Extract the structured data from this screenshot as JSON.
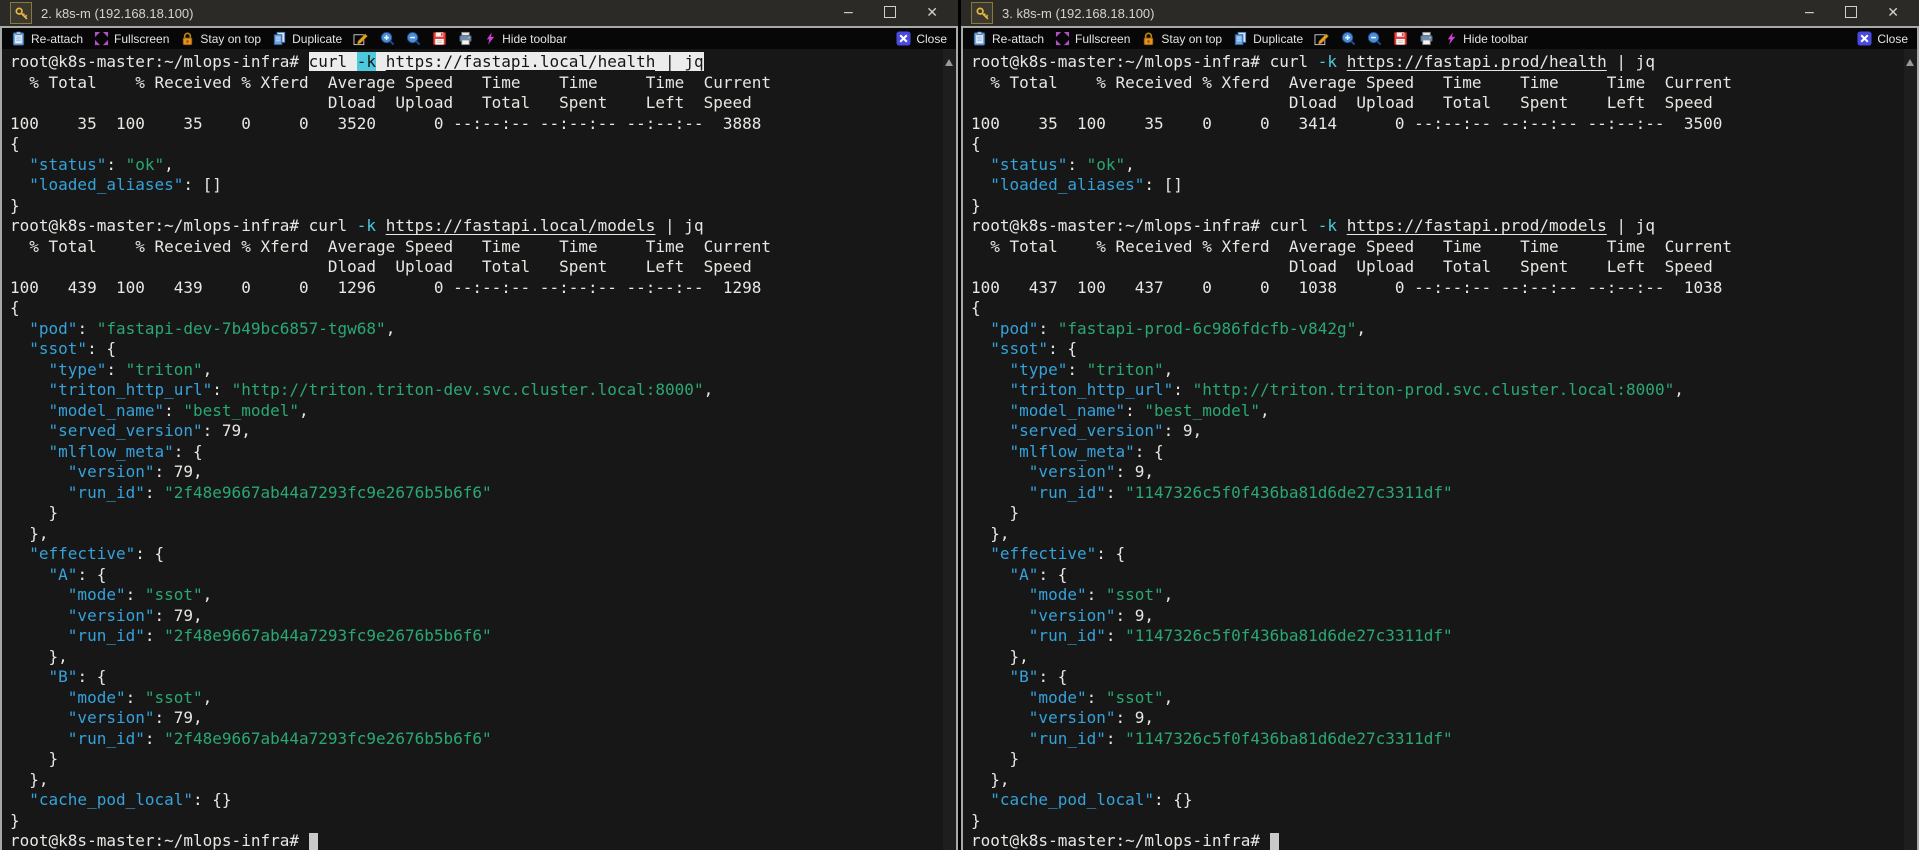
{
  "window_controls": {
    "minimize": "−",
    "close": "✕"
  },
  "toolbar": {
    "reattach": "Re-attach",
    "fullscreen": "Fullscreen",
    "stay_on_top": "Stay on top",
    "duplicate": "Duplicate",
    "hide_toolbar": "Hide toolbar",
    "close": "Close"
  },
  "left_window": {
    "title": "2. k8s-m (192.168.18.100)",
    "terminal": {
      "lines": [
        [
          [
            "t",
            "root@k8s-master:~/mlops-infra# "
          ],
          [
            "sel",
            "curl "
          ],
          [
            "selcyan",
            "-k"
          ],
          [
            "sel",
            " "
          ],
          [
            "selurl",
            "https://fastapi.local/health"
          ],
          [
            "sel",
            " | jq"
          ]
        ],
        [
          [
            "t",
            "  % Total    % Received % Xferd  Average Speed   Time    Time     Time  Current"
          ]
        ],
        [
          [
            "t",
            "                                 Dload  Upload   Total   Spent    Left  Speed"
          ]
        ],
        [
          [
            "t",
            "100    35  100    35    0     0   3520      0 --:--:-- --:--:-- --:--:--  3888"
          ]
        ],
        [
          [
            "t",
            "{"
          ]
        ],
        [
          [
            "t",
            "  "
          ],
          [
            "key",
            "\"status\""
          ],
          [
            "t",
            ": "
          ],
          [
            "str",
            "\"ok\""
          ],
          [
            "t",
            ","
          ]
        ],
        [
          [
            "t",
            "  "
          ],
          [
            "key",
            "\"loaded_aliases\""
          ],
          [
            "t",
            ": []"
          ]
        ],
        [
          [
            "t",
            "}"
          ]
        ],
        [
          [
            "t",
            "root@k8s-master:~/mlops-infra# curl "
          ],
          [
            "cyan",
            "-k"
          ],
          [
            "t",
            " "
          ],
          [
            "url",
            "https://fastapi.local/models"
          ],
          [
            "t",
            " | jq"
          ]
        ],
        [
          [
            "t",
            "  % Total    % Received % Xferd  Average Speed   Time    Time     Time  Current"
          ]
        ],
        [
          [
            "t",
            "                                 Dload  Upload   Total   Spent    Left  Speed"
          ]
        ],
        [
          [
            "t",
            "100   439  100   439    0     0   1296      0 --:--:-- --:--:-- --:--:--  1298"
          ]
        ],
        [
          [
            "t",
            "{"
          ]
        ],
        [
          [
            "t",
            "  "
          ],
          [
            "key",
            "\"pod\""
          ],
          [
            "t",
            ": "
          ],
          [
            "str",
            "\"fastapi-dev-7b49bc6857-tgw68\""
          ],
          [
            "t",
            ","
          ]
        ],
        [
          [
            "t",
            "  "
          ],
          [
            "key",
            "\"ssot\""
          ],
          [
            "t",
            ": {"
          ]
        ],
        [
          [
            "t",
            "    "
          ],
          [
            "key",
            "\"type\""
          ],
          [
            "t",
            ": "
          ],
          [
            "str",
            "\"triton\""
          ],
          [
            "t",
            ","
          ]
        ],
        [
          [
            "t",
            "    "
          ],
          [
            "key",
            "\"triton_http_url\""
          ],
          [
            "t",
            ": "
          ],
          [
            "str",
            "\"http://triton.triton-dev.svc.cluster.local:8000\""
          ],
          [
            "t",
            ","
          ]
        ],
        [
          [
            "t",
            "    "
          ],
          [
            "key",
            "\"model_name\""
          ],
          [
            "t",
            ": "
          ],
          [
            "str",
            "\"best_model\""
          ],
          [
            "t",
            ","
          ]
        ],
        [
          [
            "t",
            "    "
          ],
          [
            "key",
            "\"served_version\""
          ],
          [
            "t",
            ": 79,"
          ]
        ],
        [
          [
            "t",
            "    "
          ],
          [
            "key",
            "\"mlflow_meta\""
          ],
          [
            "t",
            ": {"
          ]
        ],
        [
          [
            "t",
            "      "
          ],
          [
            "key",
            "\"version\""
          ],
          [
            "t",
            ": 79,"
          ]
        ],
        [
          [
            "t",
            "      "
          ],
          [
            "key",
            "\"run_id\""
          ],
          [
            "t",
            ": "
          ],
          [
            "str",
            "\"2f48e9667ab44a7293fc9e2676b5b6f6\""
          ]
        ],
        [
          [
            "t",
            "    }"
          ]
        ],
        [
          [
            "t",
            "  },"
          ]
        ],
        [
          [
            "t",
            "  "
          ],
          [
            "key",
            "\"effective\""
          ],
          [
            "t",
            ": {"
          ]
        ],
        [
          [
            "t",
            "    "
          ],
          [
            "key",
            "\"A\""
          ],
          [
            "t",
            ": {"
          ]
        ],
        [
          [
            "t",
            "      "
          ],
          [
            "key",
            "\"mode\""
          ],
          [
            "t",
            ": "
          ],
          [
            "str",
            "\"ssot\""
          ],
          [
            "t",
            ","
          ]
        ],
        [
          [
            "t",
            "      "
          ],
          [
            "key",
            "\"version\""
          ],
          [
            "t",
            ": 79,"
          ]
        ],
        [
          [
            "t",
            "      "
          ],
          [
            "key",
            "\"run_id\""
          ],
          [
            "t",
            ": "
          ],
          [
            "str",
            "\"2f48e9667ab44a7293fc9e2676b5b6f6\""
          ]
        ],
        [
          [
            "t",
            "    },"
          ]
        ],
        [
          [
            "t",
            "    "
          ],
          [
            "key",
            "\"B\""
          ],
          [
            "t",
            ": {"
          ]
        ],
        [
          [
            "t",
            "      "
          ],
          [
            "key",
            "\"mode\""
          ],
          [
            "t",
            ": "
          ],
          [
            "str",
            "\"ssot\""
          ],
          [
            "t",
            ","
          ]
        ],
        [
          [
            "t",
            "      "
          ],
          [
            "key",
            "\"version\""
          ],
          [
            "t",
            ": 79,"
          ]
        ],
        [
          [
            "t",
            "      "
          ],
          [
            "key",
            "\"run_id\""
          ],
          [
            "t",
            ": "
          ],
          [
            "str",
            "\"2f48e9667ab44a7293fc9e2676b5b6f6\""
          ]
        ],
        [
          [
            "t",
            "    }"
          ]
        ],
        [
          [
            "t",
            "  },"
          ]
        ],
        [
          [
            "t",
            "  "
          ],
          [
            "key",
            "\"cache_pod_local\""
          ],
          [
            "t",
            ": {}"
          ]
        ],
        [
          [
            "t",
            "}"
          ]
        ],
        [
          [
            "t",
            "root@k8s-master:~/mlops-infra# "
          ],
          [
            "cursor",
            " "
          ]
        ]
      ]
    }
  },
  "right_window": {
    "title": "3. k8s-m (192.168.18.100)",
    "terminal": {
      "lines": [
        [
          [
            "t",
            "root@k8s-master:~/mlops-infra# curl "
          ],
          [
            "cyan",
            "-k"
          ],
          [
            "t",
            " "
          ],
          [
            "url",
            "https://fastapi.prod/health"
          ],
          [
            "t",
            " | jq"
          ]
        ],
        [
          [
            "t",
            "  % Total    % Received % Xferd  Average Speed   Time    Time     Time  Current"
          ]
        ],
        [
          [
            "t",
            "                                 Dload  Upload   Total   Spent    Left  Speed"
          ]
        ],
        [
          [
            "t",
            "100    35  100    35    0     0   3414      0 --:--:-- --:--:-- --:--:--  3500"
          ]
        ],
        [
          [
            "t",
            "{"
          ]
        ],
        [
          [
            "t",
            "  "
          ],
          [
            "key",
            "\"status\""
          ],
          [
            "t",
            ": "
          ],
          [
            "str",
            "\"ok\""
          ],
          [
            "t",
            ","
          ]
        ],
        [
          [
            "t",
            "  "
          ],
          [
            "key",
            "\"loaded_aliases\""
          ],
          [
            "t",
            ": []"
          ]
        ],
        [
          [
            "t",
            "}"
          ]
        ],
        [
          [
            "t",
            "root@k8s-master:~/mlops-infra# curl "
          ],
          [
            "cyan",
            "-k"
          ],
          [
            "t",
            " "
          ],
          [
            "url",
            "https://fastapi.prod/models"
          ],
          [
            "t",
            " | jq"
          ]
        ],
        [
          [
            "t",
            "  % Total    % Received % Xferd  Average Speed   Time    Time     Time  Current"
          ]
        ],
        [
          [
            "t",
            "                                 Dload  Upload   Total   Spent    Left  Speed"
          ]
        ],
        [
          [
            "t",
            "100   437  100   437    0     0   1038      0 --:--:-- --:--:-- --:--:--  1038"
          ]
        ],
        [
          [
            "t",
            "{"
          ]
        ],
        [
          [
            "t",
            "  "
          ],
          [
            "key",
            "\"pod\""
          ],
          [
            "t",
            ": "
          ],
          [
            "str",
            "\"fastapi-prod-6c986fdcfb-v842g\""
          ],
          [
            "t",
            ","
          ]
        ],
        [
          [
            "t",
            "  "
          ],
          [
            "key",
            "\"ssot\""
          ],
          [
            "t",
            ": {"
          ]
        ],
        [
          [
            "t",
            "    "
          ],
          [
            "key",
            "\"type\""
          ],
          [
            "t",
            ": "
          ],
          [
            "str",
            "\"triton\""
          ],
          [
            "t",
            ","
          ]
        ],
        [
          [
            "t",
            "    "
          ],
          [
            "key",
            "\"triton_http_url\""
          ],
          [
            "t",
            ": "
          ],
          [
            "str",
            "\"http://triton.triton-prod.svc.cluster.local:8000\""
          ],
          [
            "t",
            ","
          ]
        ],
        [
          [
            "t",
            "    "
          ],
          [
            "key",
            "\"model_name\""
          ],
          [
            "t",
            ": "
          ],
          [
            "str",
            "\"best_model\""
          ],
          [
            "t",
            ","
          ]
        ],
        [
          [
            "t",
            "    "
          ],
          [
            "key",
            "\"served_version\""
          ],
          [
            "t",
            ": 9,"
          ]
        ],
        [
          [
            "t",
            "    "
          ],
          [
            "key",
            "\"mlflow_meta\""
          ],
          [
            "t",
            ": {"
          ]
        ],
        [
          [
            "t",
            "      "
          ],
          [
            "key",
            "\"version\""
          ],
          [
            "t",
            ": 9,"
          ]
        ],
        [
          [
            "t",
            "      "
          ],
          [
            "key",
            "\"run_id\""
          ],
          [
            "t",
            ": "
          ],
          [
            "str",
            "\"1147326c5f0f436ba81d6de27c3311df\""
          ]
        ],
        [
          [
            "t",
            "    }"
          ]
        ],
        [
          [
            "t",
            "  },"
          ]
        ],
        [
          [
            "t",
            "  "
          ],
          [
            "key",
            "\"effective\""
          ],
          [
            "t",
            ": {"
          ]
        ],
        [
          [
            "t",
            "    "
          ],
          [
            "key",
            "\"A\""
          ],
          [
            "t",
            ": {"
          ]
        ],
        [
          [
            "t",
            "      "
          ],
          [
            "key",
            "\"mode\""
          ],
          [
            "t",
            ": "
          ],
          [
            "str",
            "\"ssot\""
          ],
          [
            "t",
            ","
          ]
        ],
        [
          [
            "t",
            "      "
          ],
          [
            "key",
            "\"version\""
          ],
          [
            "t",
            ": 9,"
          ]
        ],
        [
          [
            "t",
            "      "
          ],
          [
            "key",
            "\"run_id\""
          ],
          [
            "t",
            ": "
          ],
          [
            "str",
            "\"1147326c5f0f436ba81d6de27c3311df\""
          ]
        ],
        [
          [
            "t",
            "    },"
          ]
        ],
        [
          [
            "t",
            "    "
          ],
          [
            "key",
            "\"B\""
          ],
          [
            "t",
            ": {"
          ]
        ],
        [
          [
            "t",
            "      "
          ],
          [
            "key",
            "\"mode\""
          ],
          [
            "t",
            ": "
          ],
          [
            "str",
            "\"ssot\""
          ],
          [
            "t",
            ","
          ]
        ],
        [
          [
            "t",
            "      "
          ],
          [
            "key",
            "\"version\""
          ],
          [
            "t",
            ": 9,"
          ]
        ],
        [
          [
            "t",
            "      "
          ],
          [
            "key",
            "\"run_id\""
          ],
          [
            "t",
            ": "
          ],
          [
            "str",
            "\"1147326c5f0f436ba81d6de27c3311df\""
          ]
        ],
        [
          [
            "t",
            "    }"
          ]
        ],
        [
          [
            "t",
            "  },"
          ]
        ],
        [
          [
            "t",
            "  "
          ],
          [
            "key",
            "\"cache_pod_local\""
          ],
          [
            "t",
            ": {}"
          ]
        ],
        [
          [
            "t",
            "}"
          ]
        ],
        [
          [
            "t",
            "root@k8s-master:~/mlops-infra# "
          ],
          [
            "cursor",
            " "
          ]
        ]
      ]
    }
  }
}
